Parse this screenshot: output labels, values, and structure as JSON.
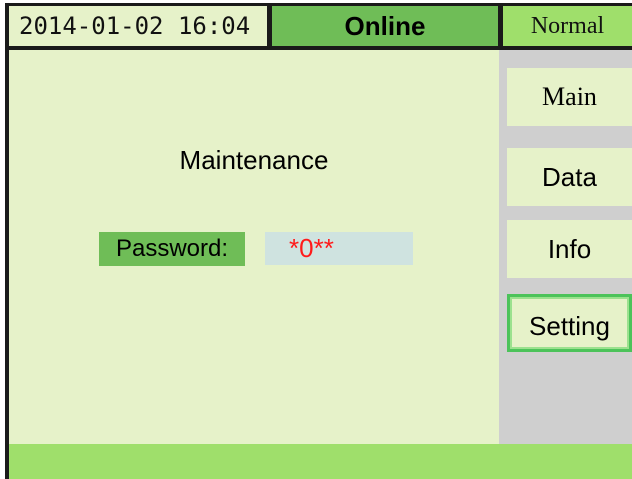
{
  "header": {
    "datetime": "2014-01-02 16:04",
    "status": "Online",
    "mode": "Normal"
  },
  "main": {
    "title": "Maintenance",
    "password_label": "Password:",
    "password_value": "*0**"
  },
  "nav": {
    "items": [
      {
        "label": "Main",
        "selected": false
      },
      {
        "label": "Data",
        "selected": false
      },
      {
        "label": "Info",
        "selected": false
      },
      {
        "label": "Setting",
        "selected": true
      }
    ]
  },
  "colors": {
    "panel_bg": "#e6f2c9",
    "accent_green": "#6fbd57",
    "light_green": "#9fdf6b",
    "password_text": "#ff1a1a",
    "sidebar_bg": "#cfcfcf",
    "selected_border": "#4cc35a"
  }
}
